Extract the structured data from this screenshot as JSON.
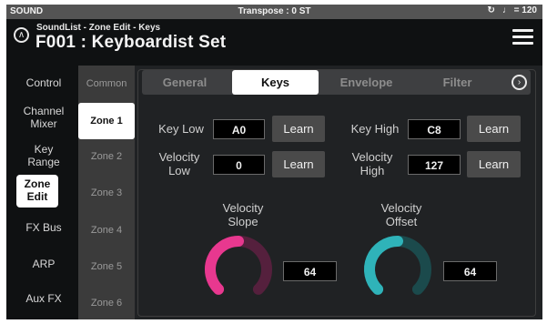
{
  "status": {
    "mode": "SOUND",
    "transpose": "Transpose : 0 ST",
    "tempo": "♩ = 120",
    "clock_icon": "metronome-icon"
  },
  "header": {
    "breadcrumb": "SoundList - Zone Edit - Keys",
    "title": "F001 : Keyboardist Set"
  },
  "nav": [
    "Control",
    "Channel Mixer",
    "Key Range",
    "Zone Edit",
    "FX Bus",
    "ARP",
    "Aux FX"
  ],
  "zones": [
    "Common",
    "Zone 1",
    "Zone 2",
    "Zone 3",
    "Zone 4",
    "Zone 5",
    "Zone 6"
  ],
  "tabs": [
    "General",
    "Keys",
    "Envelope",
    "Filter"
  ],
  "keys": {
    "key_low_label": "Key Low",
    "key_low_value": "A0",
    "key_high_label": "Key High",
    "key_high_value": "C8",
    "velocity_low_label": "Velocity Low",
    "velocity_low_value": "0",
    "velocity_high_label": "Velocity High",
    "velocity_high_value": "127",
    "learn": "Learn",
    "velocity_slope_label": "Velocity Slope",
    "velocity_slope_value": "64",
    "velocity_offset_label": "Velocity Offset",
    "velocity_offset_value": "64"
  },
  "colors": {
    "slope_accent": "#e8388f",
    "slope_track": "#55203d",
    "offset_accent": "#2fb3b9",
    "offset_track": "#1b4a4c"
  },
  "knob_levels": {
    "velocity_slope": 0.5,
    "velocity_offset": 0.5
  }
}
